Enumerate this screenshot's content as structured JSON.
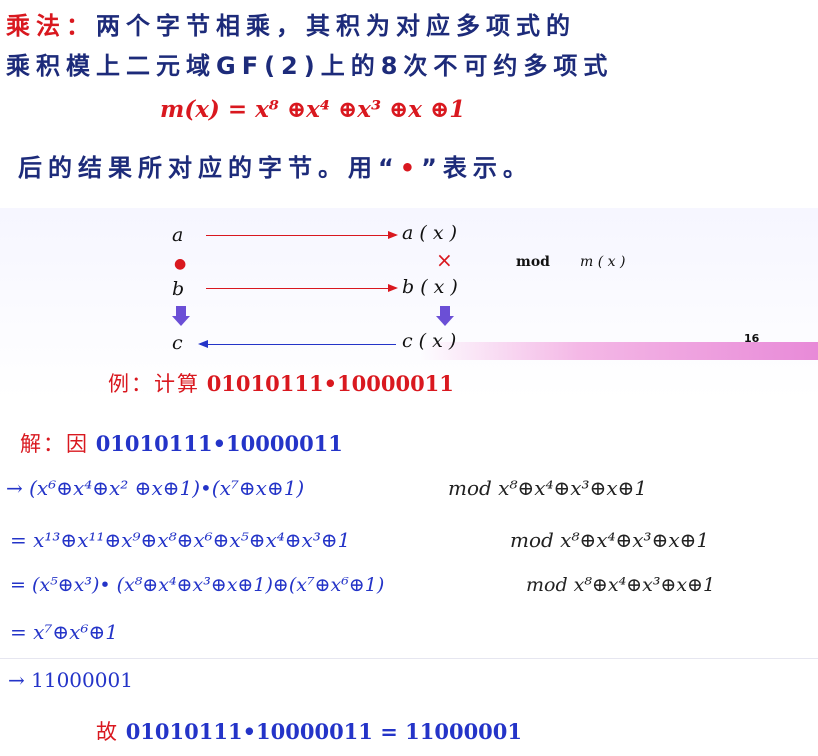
{
  "definition": {
    "line1_label": "乘法：",
    "line1_text": "两个字节相乘，其积为对应多项式的",
    "line2_text": "乘积模上二元域GF(2)上的8次不可约多项式",
    "formula": "m(x) = x⁸ ⊕x⁴ ⊕x³ ⊕x ⊕1",
    "line3_prefix": "后的结果所对应的字节。用“",
    "line3_bullet": "•",
    "line3_suffix": "”表示。"
  },
  "diagram": {
    "a": "a",
    "ax": "a ( x )",
    "b": "b",
    "bx": "b ( x )",
    "c": "c",
    "cx": "c ( x )",
    "times_symbol": "×",
    "bullet": "●",
    "mod_label": "mod",
    "mod_arg": "m ( x )",
    "page_number": "16"
  },
  "example": {
    "label": "例：计算",
    "expr": "01010111•10000011"
  },
  "solution": {
    "label": "解：因",
    "expr": "01010111•10000011",
    "step1": "→ (x⁶⊕x⁴⊕x² ⊕x⊕1)•(x⁷⊕x⊕1)",
    "step1_mod": "mod x⁸⊕x⁴⊕x³⊕x⊕1",
    "step2": "= x¹³⊕x¹¹⊕x⁹⊕x⁸⊕x⁶⊕x⁵⊕x⁴⊕x³⊕1",
    "step2_mod": "mod x⁸⊕x⁴⊕x³⊕x⊕1",
    "step3": "= (x⁵⊕x³)• (x⁸⊕x⁴⊕x³⊕x⊕1)⊕(x⁷⊕x⁶⊕1)",
    "step3_mod": "mod x⁸⊕x⁴⊕x³⊕x⊕1",
    "step4": "= x⁷⊕x⁶⊕1",
    "step5": "→ 11000001",
    "conclusion_label": "故",
    "conclusion_expr": "01010111•10000011 = 11000001"
  }
}
